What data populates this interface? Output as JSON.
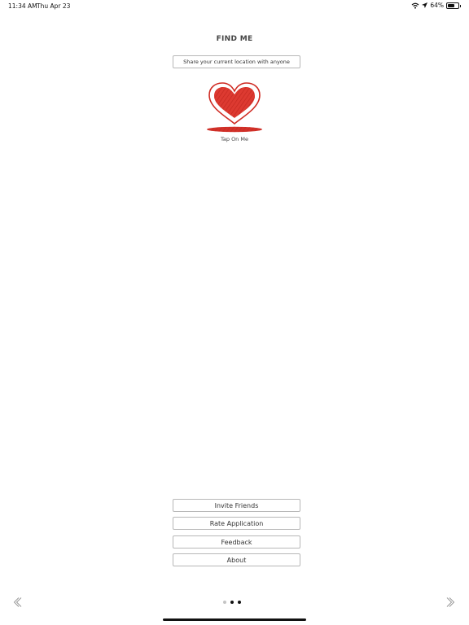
{
  "status_bar": {
    "time": "11:34 AM",
    "date": "Thu Apr 23",
    "battery_percent": "64%",
    "battery_level": 0.64,
    "icons": [
      "wifi-icon",
      "location-arrow-icon",
      "battery-icon"
    ]
  },
  "header": {
    "title": "FIND ME"
  },
  "share": {
    "label": "Share your current location with anyone"
  },
  "heart": {
    "icon": "heart-icon",
    "label": "Tap On Me",
    "color": "#d9342b"
  },
  "menu": {
    "items": [
      {
        "label": "Invite Friends"
      },
      {
        "label": "Rate Application"
      },
      {
        "label": "Feedback"
      },
      {
        "label": "About"
      }
    ]
  },
  "pager": {
    "page_count": 3,
    "active_indices": [
      1,
      2
    ]
  },
  "nav": {
    "prev_icon": "chevron-left-icon",
    "next_icon": "chevron-right-icon"
  }
}
